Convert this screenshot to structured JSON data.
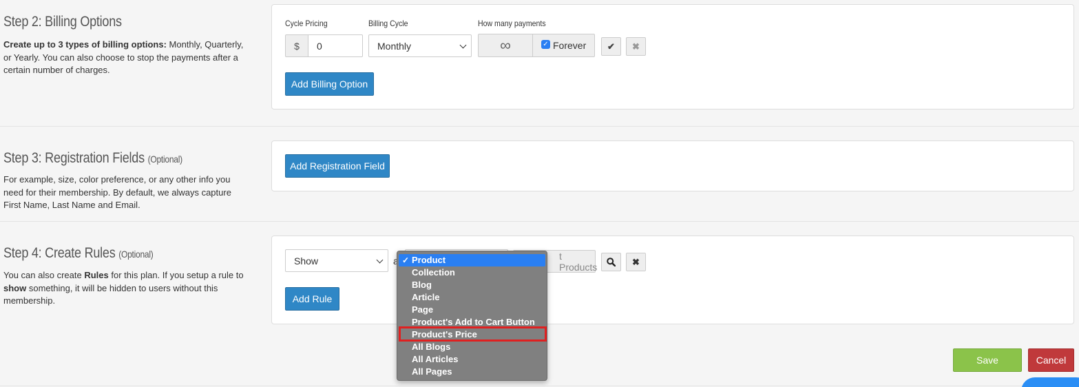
{
  "step2": {
    "title": "Step 2: Billing Options",
    "desc_bold": "Create up to 3 types of billing options:",
    "desc_rest": " Monthly, Quarterly, or Yearly. You can also choose to stop the payments after a certain number of charges.",
    "cycle_pricing_label": "Cycle Pricing",
    "currency_symbol": "$",
    "price_value": "0",
    "billing_cycle_label": "Billing Cycle",
    "billing_cycle_value": "Monthly",
    "payments_label": "How many payments",
    "infinity_symbol": "∞",
    "forever_label": "Forever",
    "forever_checked": true,
    "add_button": "Add Billing Option"
  },
  "step3": {
    "title": "Step 3: Registration Fields",
    "optional": "(Optional)",
    "desc": "For example, size, color preference, or any other info you need for their membership. By default, we always capture First Name, Last Name and Email.",
    "add_button": "Add Registration Field"
  },
  "step4": {
    "title": "Step 4: Create Rules",
    "optional": "(Optional)",
    "desc_1": "You can also create ",
    "desc_bold_1": "Rules",
    "desc_2": " for this plan. If you setup a rule to ",
    "desc_bold_2": "show",
    "desc_3": " something, it will be hidden to users without this membership.",
    "action_select_value": "Show",
    "connector_text": "a",
    "search_placeholder_visible": "t Products",
    "add_button": "Add Rule"
  },
  "dropdown": {
    "items": [
      "Product",
      "Collection",
      "Blog",
      "Article",
      "Page",
      "Product's Add to Cart Button",
      "Product's Price",
      "All Blogs",
      "All Articles",
      "All Pages"
    ],
    "check_mark": "✓"
  },
  "footer": {
    "save": "Save",
    "cancel": "Cancel"
  },
  "colors": {
    "primary_blue": "#2f87c6",
    "save_green": "#8bc34a",
    "cancel_red": "#c0393b",
    "dropdown_bg": "#808080",
    "dropdown_selected": "#2a7ff2",
    "highlight": "#e02020"
  }
}
